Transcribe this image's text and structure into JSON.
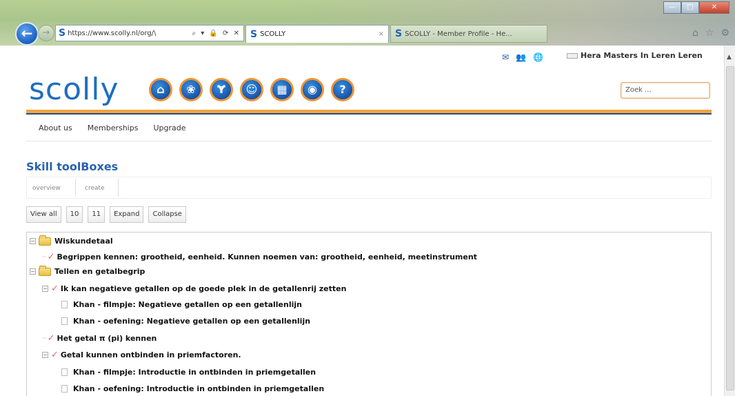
{
  "browser": {
    "address": "https://www.scolly.nl/org/\\",
    "address_controls": "⌕ ▾ 🔒 ⟳ ✕",
    "tabs": [
      {
        "label": "SCOLLY",
        "close": "×"
      },
      {
        "label": "SCOLLY - Member Profile - He..."
      }
    ]
  },
  "header": {
    "logo": "scolly",
    "user_name": "Hera Masters In Leren Leren",
    "search_placeholder": "Zoek ...",
    "nav_icons": [
      "home-icon",
      "group-icon",
      "tree-icon",
      "users-icon",
      "grid-icon",
      "profile-icon",
      "help-icon"
    ]
  },
  "topmenu": [
    "About us",
    "Memberships",
    "Upgrade"
  ],
  "section": {
    "title": "Skill toolBoxes",
    "subtabs": [
      "overview",
      "create"
    ]
  },
  "toolbar": [
    "View all",
    "10",
    "11",
    "Expand",
    "Collapse"
  ],
  "tree": [
    {
      "type": "folder",
      "label": "Wiskundetaal"
    },
    {
      "type": "skill",
      "label": "Begrippen kennen: grootheid, eenheid. Kunnen noemen van: grootheid, eenheid, meetinstrument"
    },
    {
      "type": "folder",
      "label": "Tellen en getalbegrip"
    },
    {
      "type": "skill",
      "label": "Ik kan negatieve getallen op de goede plek in de getallenrij zetten"
    },
    {
      "type": "doc",
      "label": "Khan - filmpje: Negatieve getallen op een getallenlijn"
    },
    {
      "type": "doc",
      "label": "Khan - oefening: Negatieve getallen op een getallenlijn"
    },
    {
      "type": "skill",
      "label": "Het getal π (pi) kennen"
    },
    {
      "type": "skill",
      "label": "Getal kunnen ontbinden in priemfactoren."
    },
    {
      "type": "doc",
      "label": "Khan - filmpje: Introductie in ontbinden in priemgetallen"
    },
    {
      "type": "doc",
      "label": "Khan - oefening: Introductie in ontbinden in priemgetallen"
    }
  ],
  "colors": {
    "accent_orange": "#f0a43e",
    "brand_blue": "#1f6ec0"
  }
}
